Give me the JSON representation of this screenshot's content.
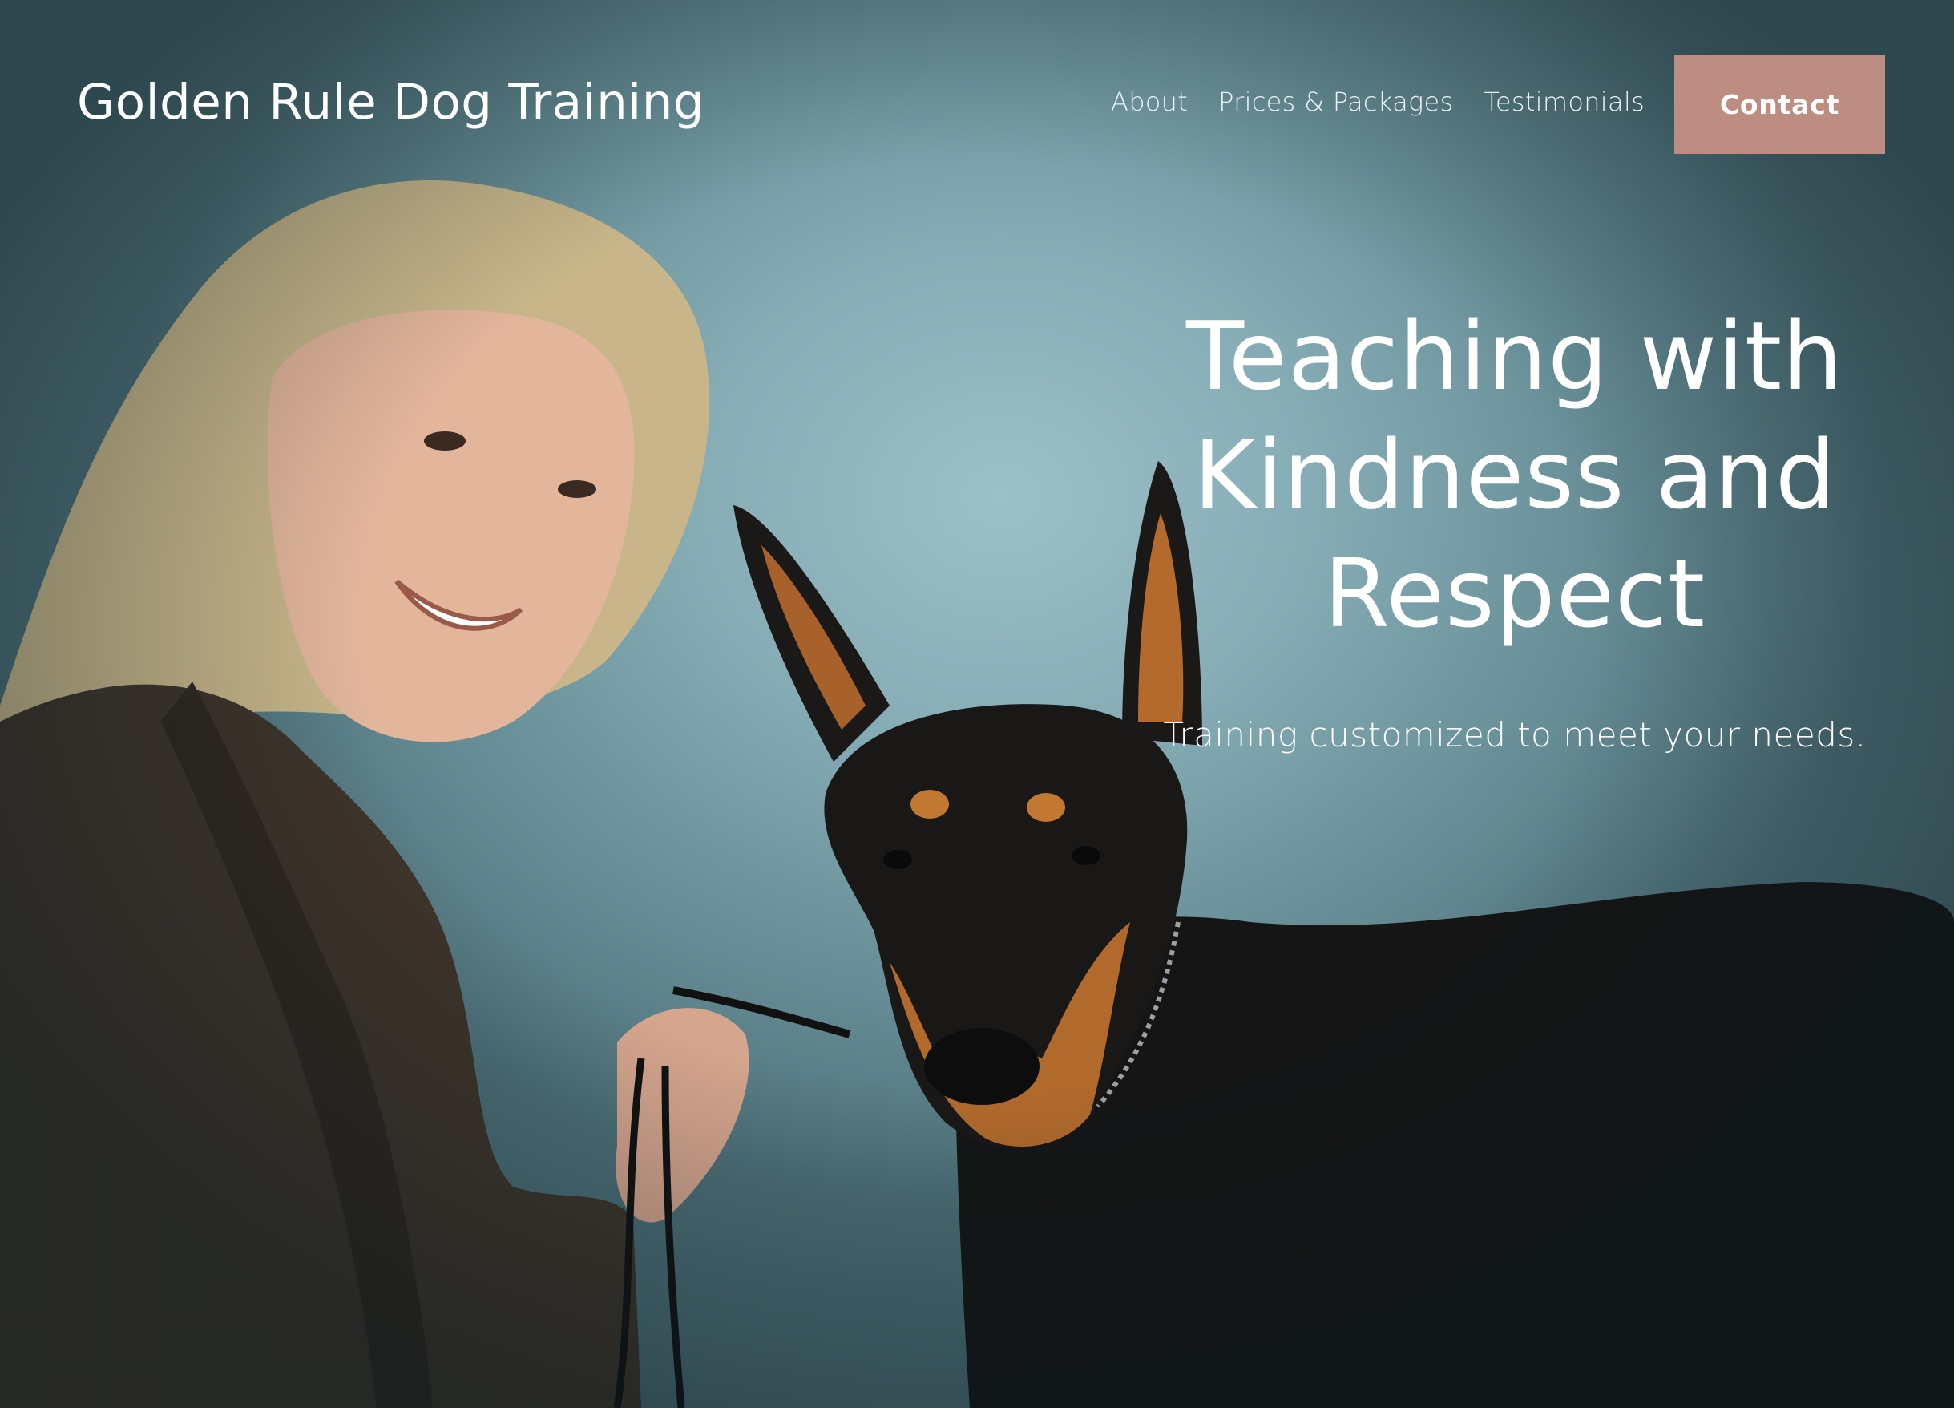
{
  "header": {
    "site_title": "Golden Rule Dog Training",
    "nav": [
      {
        "label": "About"
      },
      {
        "label": "Prices & Packages"
      },
      {
        "label": "Testimonials"
      }
    ],
    "contact_label": "Contact"
  },
  "hero": {
    "headline_lines": [
      "Teaching with",
      "Kindness and",
      "Respect"
    ],
    "subheadline": "Training customized to meet your needs.",
    "image": "hero-photo woman-with-doberman"
  },
  "colors": {
    "accent": "#bd8d82",
    "background": "#86acb5",
    "text": "#ffffff"
  }
}
